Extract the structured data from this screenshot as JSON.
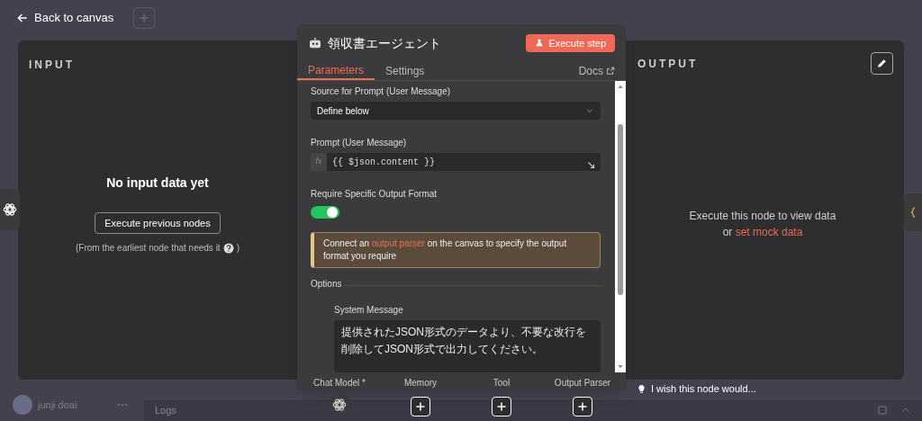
{
  "top_bar": {
    "back_link": "Back to canvas"
  },
  "input_panel": {
    "title": "INPUT",
    "empty_title": "No input data yet",
    "button": "Execute previous nodes",
    "hint_before": "(From the earliest node that needs it",
    "hint_after": ")"
  },
  "node": {
    "title": "領収書エージェント",
    "execute_button": "Execute step",
    "tabs": [
      {
        "label": "Parameters",
        "selected": true
      },
      {
        "label": "Settings",
        "selected": false
      }
    ],
    "docs_link": "Docs",
    "fields": [
      {
        "kind": "select",
        "label": "Source for Prompt (User Message)",
        "value": "Define below"
      },
      {
        "kind": "expression",
        "label": "Prompt (User Message)",
        "prefix": "fx",
        "value": "{{ $json.content }}"
      },
      {
        "kind": "toggle",
        "label": "Require Specific Output Format",
        "on": true
      },
      {
        "kind": "notice",
        "before": "Connect an ",
        "link": "output parser",
        "after": " on the canvas to specify the output format you require"
      }
    ],
    "options": {
      "label": "Options",
      "fields": [
        {
          "label": "System Message",
          "value": "提供されたJSON形式のデータより、不要な改行を削除してJSON形式で出力してください。"
        }
      ]
    },
    "connectors": [
      {
        "label": "Chat Model *",
        "kind": "model"
      },
      {
        "label": "Memory",
        "kind": "add"
      },
      {
        "label": "Tool",
        "kind": "add"
      },
      {
        "label": "Output Parser",
        "kind": "add"
      }
    ]
  },
  "output_panel": {
    "title": "OUTPUT",
    "message": "Execute this node to view data",
    "or_text": "or ",
    "link": "set mock data"
  },
  "feedback": "I wish this node would...",
  "sidebar_user": {
    "name": "junji doai"
  },
  "logs": {
    "title": "Logs"
  }
}
